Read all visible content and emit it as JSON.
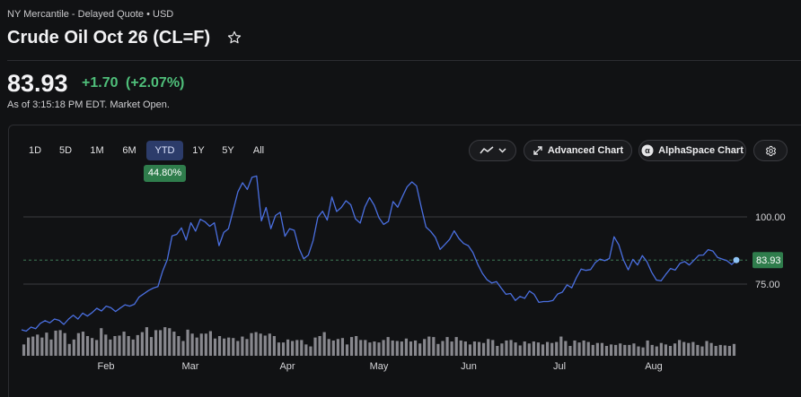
{
  "header": {
    "breadcrumb": "NY Mercantile - Delayed Quote • USD",
    "title": "Crude Oil Oct 26 (CL=F)",
    "price": "83.93",
    "change": "+1.70",
    "change_pct": "(+2.07%)",
    "as_of": "As of 3:15:18 PM EDT. Market Open.",
    "up_color": "#4fbf7a"
  },
  "toolbar": {
    "ranges": [
      "1D",
      "5D",
      "1M",
      "6M",
      "YTD",
      "1Y",
      "5Y",
      "All"
    ],
    "active_range": "YTD",
    "range_return": "44.80%",
    "chart_type_icon": "line-chart-icon",
    "advanced_chart": "Advanced Chart",
    "alphaspace_chart": "AlphaSpace Chart",
    "settings_icon": "gear-icon"
  },
  "chart_data": {
    "type": "line",
    "x_ticks": [
      "Feb",
      "Mar",
      "Apr",
      "May",
      "Jun",
      "Jul",
      "Aug"
    ],
    "y_ticks": [
      75.0,
      100.0
    ],
    "y_tick_labels": [
      "75.00",
      "100.00"
    ],
    "current_value": 83.93,
    "current_label": "83.93",
    "line_color": "#4a6fe0",
    "volume_color": "#9e9ea3",
    "series": [
      {
        "values": [
          58.0,
          57.5,
          59.0,
          58.4,
          60.4,
          61.4,
          60.6,
          62.0,
          61.5,
          60.0,
          62.0,
          63.4,
          62.0,
          64.2,
          63.1,
          64.4,
          66.0,
          65.0,
          66.8,
          66.2,
          64.8,
          66.1,
          67.3,
          66.8,
          67.5,
          70.2,
          71.4,
          72.6,
          73.5,
          74.1,
          79.8,
          84.1,
          92.9,
          93.5,
          95.9,
          91.4,
          97.8,
          94.7,
          99.1,
          98.2,
          96.5,
          97.8,
          89.3,
          94.2,
          95.6,
          102.4,
          109.3,
          112.7,
          110.2,
          114.7,
          115.2,
          98.5,
          103.5,
          95.6,
          100.5,
          101.7,
          92.8,
          95.6,
          95.0,
          88.3,
          84.4,
          85.8,
          91.2,
          99.8,
          102.1,
          98.8,
          107.4,
          102.0,
          103.5,
          106.0,
          104.5,
          99.3,
          97.7,
          103.7,
          107.2,
          104.3,
          99.7,
          97.2,
          98.3,
          105.7,
          103.6,
          107.6,
          111.2,
          113.0,
          111.5,
          103.6,
          96.2,
          94.6,
          92.4,
          87.9,
          89.7,
          91.6,
          94.8,
          92.0,
          90.1,
          89.3,
          86.7,
          82.4,
          79.0,
          76.6,
          75.4,
          75.9,
          73.5,
          71.2,
          71.5,
          68.9,
          70.4,
          69.7,
          72.4,
          71.2,
          68.2,
          68.5,
          68.5,
          68.9,
          71.3,
          72.0,
          74.7,
          73.6,
          77.4,
          80.6,
          80.1,
          80.4,
          83.0,
          84.3,
          83.7,
          84.5,
          92.6,
          89.6,
          84.0,
          80.3,
          84.2,
          82.1,
          85.6,
          83.3,
          79.4,
          76.5,
          76.2,
          78.6,
          80.8,
          80.2,
          82.7,
          83.4,
          82.1,
          83.9,
          85.7,
          85.8,
          87.8,
          87.3,
          84.9,
          84.3,
          83.7,
          82.3,
          83.9
        ]
      }
    ],
    "volume": [
      0.23,
      0.37,
      0.39,
      0.43,
      0.37,
      0.47,
      0.33,
      0.51,
      0.52,
      0.46,
      0.24,
      0.33,
      0.46,
      0.49,
      0.4,
      0.36,
      0.32,
      0.56,
      0.43,
      0.33,
      0.4,
      0.41,
      0.49,
      0.4,
      0.33,
      0.42,
      0.48,
      0.58,
      0.38,
      0.52,
      0.52,
      0.58,
      0.56,
      0.49,
      0.4,
      0.3,
      0.53,
      0.45,
      0.37,
      0.45,
      0.45,
      0.5,
      0.35,
      0.4,
      0.35,
      0.37,
      0.36,
      0.3,
      0.39,
      0.34,
      0.46,
      0.48,
      0.45,
      0.41,
      0.45,
      0.4,
      0.27,
      0.27,
      0.33,
      0.3,
      0.32,
      0.32,
      0.23,
      0.19,
      0.37,
      0.4,
      0.48,
      0.34,
      0.31,
      0.34,
      0.36,
      0.23,
      0.38,
      0.4,
      0.32,
      0.32,
      0.27,
      0.29,
      0.27,
      0.32,
      0.38,
      0.31,
      0.3,
      0.29,
      0.35,
      0.29,
      0.31,
      0.25,
      0.34,
      0.39,
      0.38,
      0.24,
      0.3,
      0.38,
      0.29,
      0.38,
      0.31,
      0.29,
      0.23,
      0.29,
      0.28,
      0.26,
      0.34,
      0.32,
      0.2,
      0.25,
      0.31,
      0.32,
      0.27,
      0.21,
      0.29,
      0.25,
      0.29,
      0.27,
      0.23,
      0.28,
      0.26,
      0.28,
      0.39,
      0.3,
      0.2,
      0.31,
      0.27,
      0.31,
      0.28,
      0.22,
      0.26,
      0.26,
      0.2,
      0.23,
      0.22,
      0.25,
      0.22,
      0.22,
      0.25,
      0.19,
      0.17,
      0.31,
      0.22,
      0.19,
      0.26,
      0.23,
      0.2,
      0.25,
      0.32,
      0.28,
      0.26,
      0.28,
      0.22,
      0.19,
      0.3,
      0.26,
      0.2,
      0.22,
      0.21,
      0.2,
      0.24
    ]
  }
}
